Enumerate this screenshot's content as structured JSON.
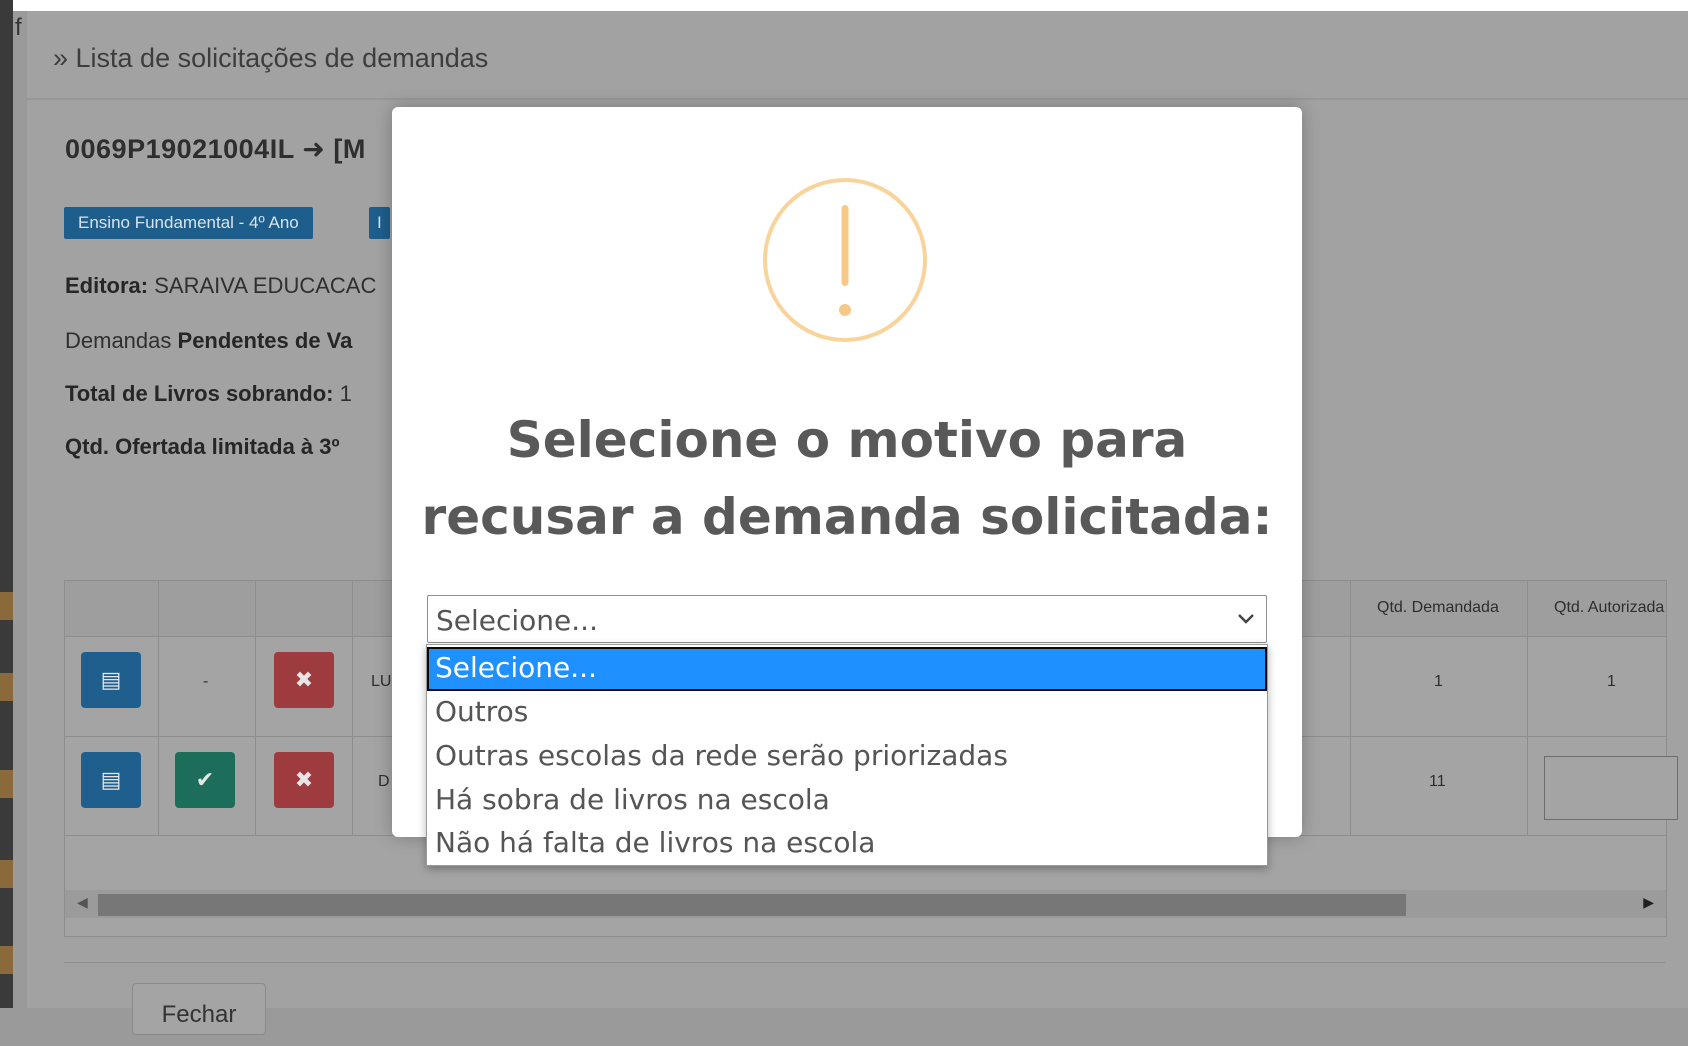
{
  "page": {
    "corner_letter": "f",
    "breadcrumb": "» Lista de solicitações de demandas",
    "code_title": "0069P19021004IL ➜ [M",
    "badges": [
      "Ensino Fundamental - 4º Ano",
      "I"
    ],
    "editora_label": "Editora:",
    "editora_value": "SARAIVA EDUCACAC",
    "demandas_text": "Demandas",
    "demandas_bold": "Pendentes de Va",
    "total_label": "Total de Livros sobrando:",
    "total_value": "1",
    "qtd_ofertada": "Qtd. Ofertada limitada à 3º",
    "close_button": "Fechar"
  },
  "table": {
    "headers": {
      "qtd_demandada": "Qtd. Demandada",
      "qtd_autorizada": "Qtd. Autorizada"
    },
    "rows": [
      {
        "status": "-",
        "name_prefix": "LU",
        "qtd_demandada": "1",
        "qtd_autorizada": "1"
      },
      {
        "name_prefix": "D",
        "qtd_demandada": "11",
        "qtd_autorizada": ""
      }
    ]
  },
  "modal": {
    "icon": "exclamation-circle-icon",
    "icon_color": "#f8bb86",
    "title_line1": "Selecione o motivo para",
    "title_line2": "recusar a demanda solicitada:",
    "select": {
      "value": "Selecione...",
      "options": [
        "Selecione...",
        "Outros",
        "Outras escolas da rede serão priorizadas",
        "Há sobra de livros na escola",
        "Não há falta de livros na escola"
      ],
      "highlighted_index": 0
    }
  },
  "colors": {
    "overlay_bg": "#9a9a9a",
    "option_highlight": "#1e90ff"
  }
}
